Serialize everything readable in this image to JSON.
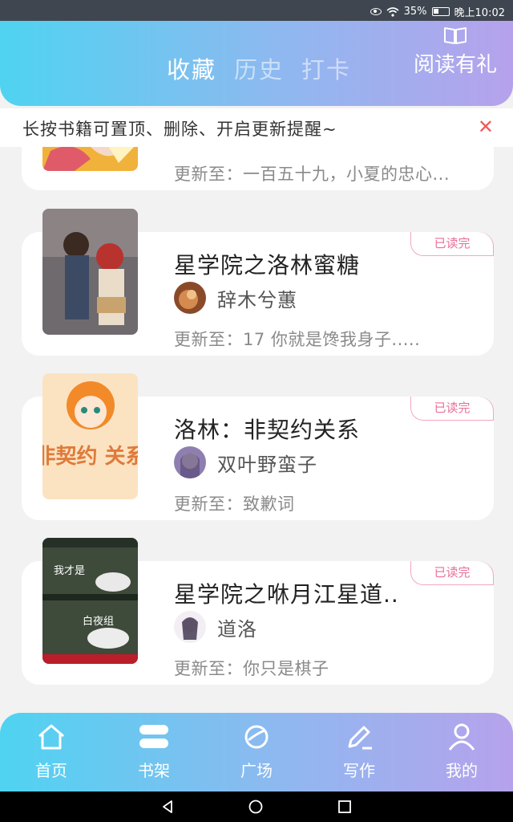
{
  "status_bar": {
    "battery": "35%",
    "time": "晚上10:02"
  },
  "header": {
    "tabs": [
      "收藏",
      "历史",
      "打卡"
    ],
    "active_tab": 0,
    "gift_label": "阅读有礼",
    "gift_icon": "book-open-icon"
  },
  "tip": {
    "text": "长按书籍可置顶、删除、开启更新提醒~",
    "close_icon": "close-icon"
  },
  "books": [
    {
      "title": "",
      "author": "",
      "update": "更新至：一百五十九，小夏的忠心..."
    },
    {
      "title": "星学院之洛林蜜糖",
      "author": "辞木兮蕙",
      "update": "更新至：17  你就是馋我身子.....",
      "badge": "已读完"
    },
    {
      "title": "洛林：非契约关系",
      "author": "双叶野蛮子",
      "update": "更新至：致歉词",
      "badge": "已读完"
    },
    {
      "title": "星学院之咻月江星道..",
      "author": "道洛",
      "update": "更新至：你只是棋子",
      "badge": "已读完"
    }
  ],
  "cover_texts": {
    "book2_art": "非契约 关系",
    "book3_line1": "我才是",
    "book3_line2": "白夜组"
  },
  "bottom_nav": [
    "首页",
    "书架",
    "广场",
    "写作",
    "我的"
  ],
  "colors": {
    "gradient_start": "#4fd3f1",
    "gradient_end": "#b6a2ec",
    "badge": "#ea6f96",
    "close": "#ee5a5a"
  }
}
